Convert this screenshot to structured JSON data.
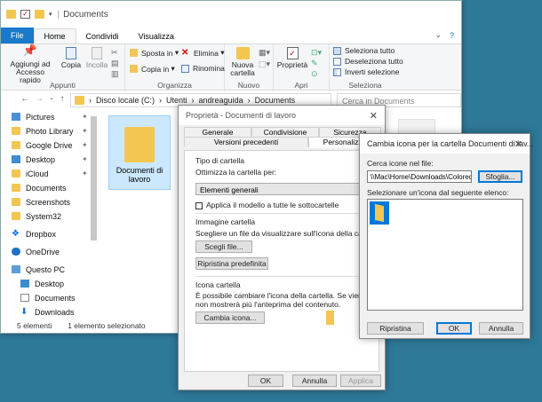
{
  "explorer": {
    "title": "Documents",
    "ribbon_tabs": [
      "File",
      "Home",
      "Condividi",
      "Visualizza"
    ],
    "clipboard": {
      "pin_label": "Aggiungi ad Accesso rapido",
      "copy_label": "Copia",
      "paste_label": "Incolla",
      "group_label": "Appunti"
    },
    "organize": {
      "move_label": "Sposta in",
      "copy_to_label": "Copia in",
      "delete_label": "Elimina",
      "rename_label": "Rinomina",
      "group_label": "Organizza"
    },
    "new": {
      "new_folder_label": "Nuova cartella",
      "group_label": "Nuovo"
    },
    "open": {
      "properties_label": "Proprietà",
      "group_label": "Apri"
    },
    "select": {
      "select_all": "Seleziona tutto",
      "deselect_all": "Deseleziona tutto",
      "invert": "Inverti selezione",
      "group_label": "Seleziona"
    },
    "breadcrumb": [
      "Disco locale (C:)",
      "Utenti",
      "andreaguida",
      "Documents"
    ],
    "search_placeholder": "Cerca in Documents",
    "nav_items": [
      "Pictures",
      "Photo Library",
      "Google Drive",
      "Desktop",
      "iCloud",
      "Documents",
      "Screenshots",
      "System32",
      "Dropbox",
      "OneDrive",
      "Questo PC",
      "Desktop",
      "Documents",
      "Downloads"
    ],
    "folder_name": "Documenti di lavoro",
    "status": {
      "count": "5 elementi",
      "selected": "1 elemento selezionato"
    }
  },
  "properties": {
    "title": "Proprietà - Documenti di lavoro",
    "tabs": [
      "Generale",
      "Condivisione",
      "Sicurezza",
      "Versioni precedenti",
      "Personalizza"
    ],
    "folder_type_heading": "Tipo di cartella",
    "optimize_label": "Ottimizza la cartella per:",
    "optimize_value": "Elementi generali",
    "apply_subfolders": "Applica il modello a tutte le sottocartelle",
    "folder_image_heading": "Immagine cartella",
    "folder_image_desc": "Scegliere un file da visualizzare sull'icona della cartella.",
    "choose_file": "Scegli file...",
    "restore_default": "Ripristina predefinita",
    "folder_icon_heading": "Icona cartella",
    "folder_icon_desc_1": "È possibile cambiare l'icona della cartella. Se viene cambiata",
    "folder_icon_desc_2": "non mostrerà più l'anteprima del contenuto.",
    "change_icon": "Cambia icona...",
    "ok": "OK",
    "cancel": "Annulla",
    "apply": "Applica"
  },
  "change_icon": {
    "title": "Cambia icona per la cartella Documenti di lav...",
    "search_label": "Cerca icone nel file:",
    "path_value": "\\\\Mac\\Home\\Downloads\\Colored Win",
    "browse": "Sfoglia...",
    "list_label": "Selezionare un'icona dal seguente elenco:",
    "restore": "Ripristina",
    "ok": "OK",
    "cancel": "Annulla"
  },
  "colors": {
    "accent": "#1979ca",
    "folder": "#f3c652",
    "desktop": "#2e7898"
  }
}
